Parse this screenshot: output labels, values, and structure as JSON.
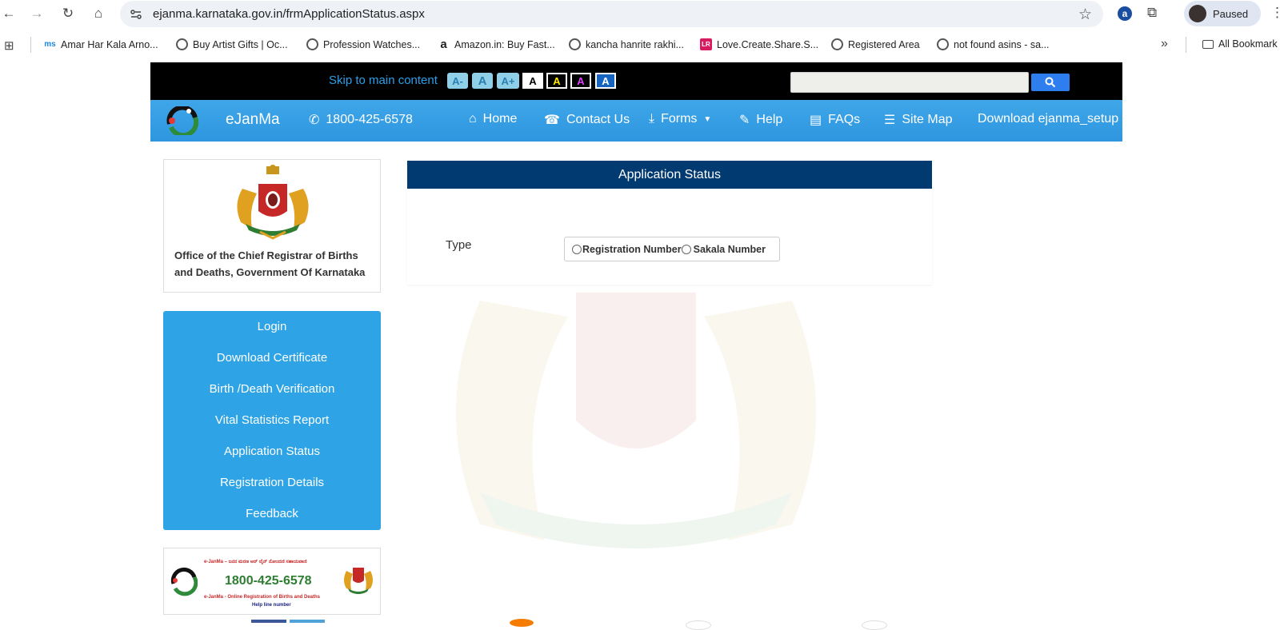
{
  "browser": {
    "url": "ejanma.karnataka.gov.in/frmApplicationStatus.aspx",
    "profile_status": "Paused",
    "bookmarks": [
      {
        "label": "Amar Har Kala Arno...",
        "icon": "ms"
      },
      {
        "label": "Buy Artist Gifts | Oc...",
        "icon": "globe"
      },
      {
        "label": "Profession Watches...",
        "icon": "globe"
      },
      {
        "label": "Amazon.in: Buy Fast...",
        "icon": "a"
      },
      {
        "label": "kancha hanrite rakhi...",
        "icon": "globe"
      },
      {
        "label": "Love.Create.Share.S...",
        "icon": "LR"
      },
      {
        "label": "Registered Area",
        "icon": "globe"
      },
      {
        "label": "not found asins - sa...",
        "icon": "globe"
      }
    ],
    "all_bookmarks": "All Bookmark"
  },
  "topbar": {
    "skip_link": "Skip to main content",
    "font_buttons": [
      "A-",
      "A",
      "A+",
      "A",
      "A",
      "A",
      "A"
    ]
  },
  "navbar": {
    "brand": "eJanMa",
    "phone": "1800-425-6578",
    "items": [
      "Home",
      "Contact Us",
      "Forms",
      "Help",
      "FAQs",
      "Site Map",
      "Download ejanma_setup"
    ]
  },
  "sidebar": {
    "office_text": "Office of the Chief Registrar of Births and Deaths, Government Of Karnataka",
    "menu": [
      "Login",
      "Download Certificate",
      "Birth /Death Verification",
      "Vital Statistics Report",
      "Application Status",
      "Registration Details",
      "Feedback"
    ],
    "helpline": {
      "top_text": "e-JanMa – ಜನನ ಮರಣ ಆನ್ ಲೈನ್ ನೋಂದಣಿ ಸಹಾಯವಾಣಿ",
      "number": "1800-425-6578",
      "bottom_text": "e-JanMa - Online Registration of Births and Deaths",
      "sub_text": "Help line number"
    }
  },
  "main": {
    "title": "Application Status",
    "type_label": "Type",
    "options": [
      "Registration Number",
      "Sakala Number"
    ]
  },
  "colors": {
    "nav_blue": "#2e96e0",
    "panel_header": "#003a70",
    "menu_blue": "#2ea3e5"
  }
}
